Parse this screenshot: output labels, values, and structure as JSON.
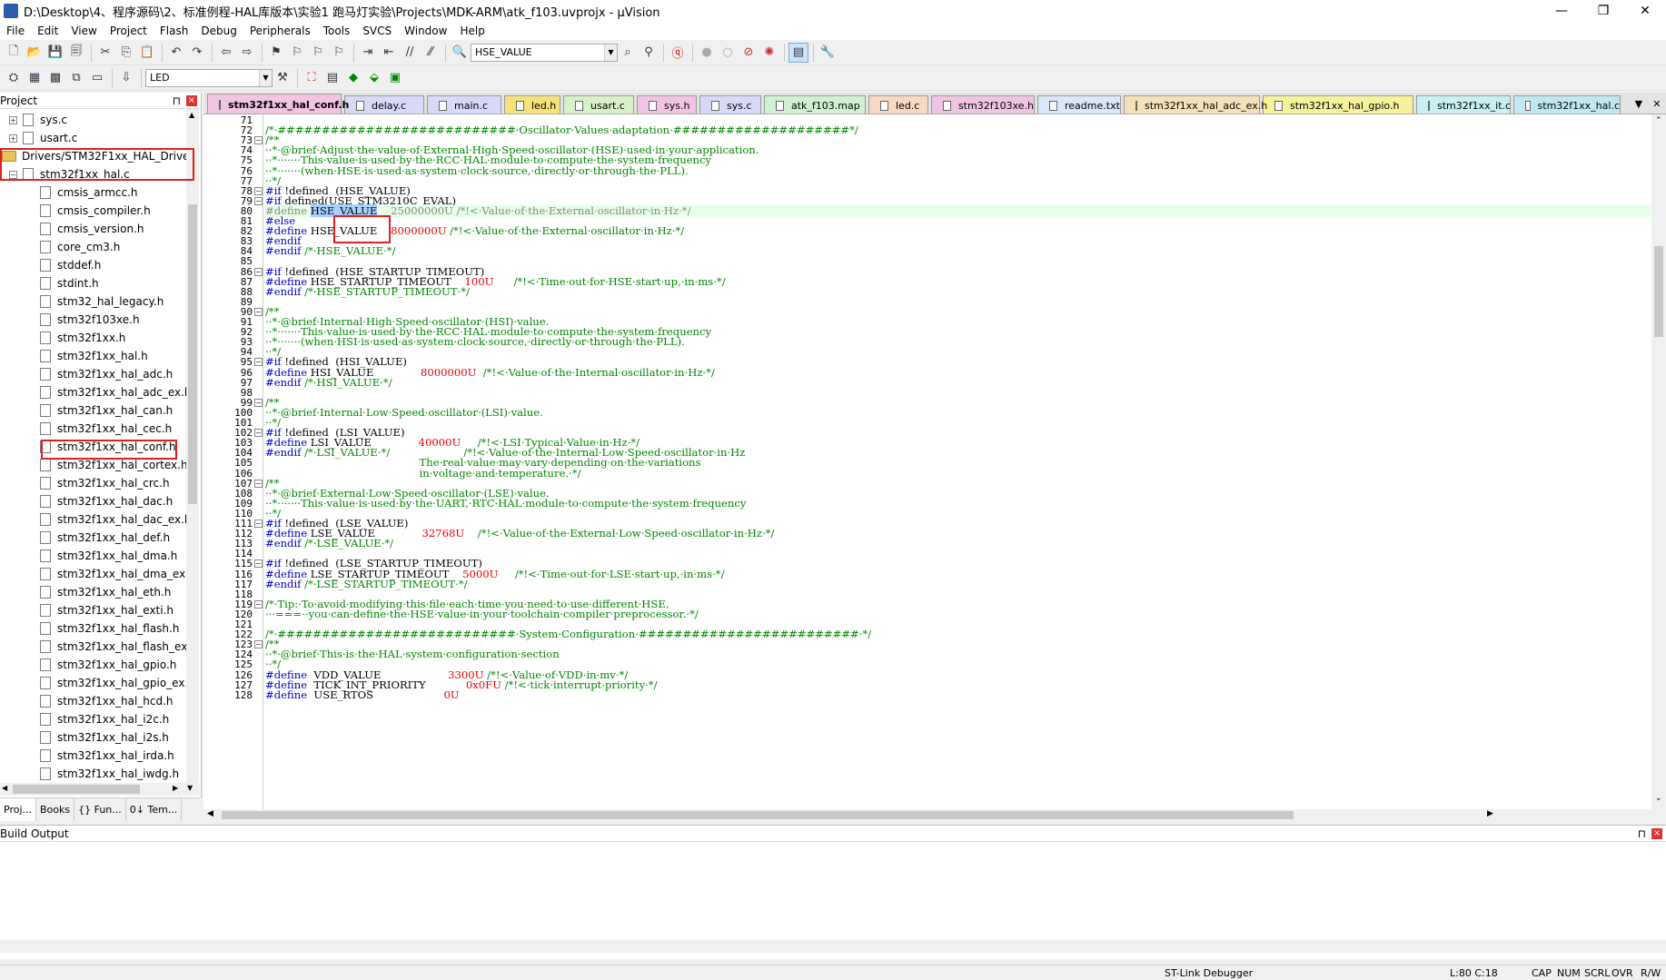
{
  "window": {
    "title": "D:\\Desktop\\4、程序源码\\2、标准例程-HAL库版本\\实验1 跑马灯实验\\Projects\\MDK-ARM\\atk_f103.uvprojx - µVision",
    "minimize": "—",
    "maximize": "❐",
    "close": "✕"
  },
  "menu": [
    "File",
    "Edit",
    "View",
    "Project",
    "Flash",
    "Debug",
    "Peripherals",
    "Tools",
    "SVCS",
    "Window",
    "Help"
  ],
  "toolbar": {
    "find_value": "HSE_VALUE",
    "target_value": "LED"
  },
  "project": {
    "title": "Project",
    "pin": "⊓",
    "close": "×",
    "items": [
      {
        "label": "sys.c",
        "kind": "file-expand"
      },
      {
        "label": "usart.c",
        "kind": "file-expand"
      },
      {
        "label": "Drivers/STM32F1xx_HAL_Driver",
        "kind": "folder"
      },
      {
        "label": "stm32f1xx_hal.c",
        "kind": "file-collapse"
      },
      {
        "label": "cmsis_armcc.h",
        "kind": "file"
      },
      {
        "label": "cmsis_compiler.h",
        "kind": "file"
      },
      {
        "label": "cmsis_version.h",
        "kind": "file"
      },
      {
        "label": "core_cm3.h",
        "kind": "file"
      },
      {
        "label": "stddef.h",
        "kind": "file"
      },
      {
        "label": "stdint.h",
        "kind": "file"
      },
      {
        "label": "stm32_hal_legacy.h",
        "kind": "file"
      },
      {
        "label": "stm32f103xe.h",
        "kind": "file"
      },
      {
        "label": "stm32f1xx.h",
        "kind": "file"
      },
      {
        "label": "stm32f1xx_hal.h",
        "kind": "file"
      },
      {
        "label": "stm32f1xx_hal_adc.h",
        "kind": "file"
      },
      {
        "label": "stm32f1xx_hal_adc_ex.h",
        "kind": "file"
      },
      {
        "label": "stm32f1xx_hal_can.h",
        "kind": "file"
      },
      {
        "label": "stm32f1xx_hal_cec.h",
        "kind": "file"
      },
      {
        "label": "stm32f1xx_hal_conf.h",
        "kind": "file"
      },
      {
        "label": "stm32f1xx_hal_cortex.h",
        "kind": "file"
      },
      {
        "label": "stm32f1xx_hal_crc.h",
        "kind": "file"
      },
      {
        "label": "stm32f1xx_hal_dac.h",
        "kind": "file"
      },
      {
        "label": "stm32f1xx_hal_dac_ex.h",
        "kind": "file"
      },
      {
        "label": "stm32f1xx_hal_def.h",
        "kind": "file"
      },
      {
        "label": "stm32f1xx_hal_dma.h",
        "kind": "file"
      },
      {
        "label": "stm32f1xx_hal_dma_ex.h",
        "kind": "file"
      },
      {
        "label": "stm32f1xx_hal_eth.h",
        "kind": "file"
      },
      {
        "label": "stm32f1xx_hal_exti.h",
        "kind": "file"
      },
      {
        "label": "stm32f1xx_hal_flash.h",
        "kind": "file"
      },
      {
        "label": "stm32f1xx_hal_flash_ex.h",
        "kind": "file"
      },
      {
        "label": "stm32f1xx_hal_gpio.h",
        "kind": "file"
      },
      {
        "label": "stm32f1xx_hal_gpio_ex.h",
        "kind": "file"
      },
      {
        "label": "stm32f1xx_hal_hcd.h",
        "kind": "file"
      },
      {
        "label": "stm32f1xx_hal_i2c.h",
        "kind": "file"
      },
      {
        "label": "stm32f1xx_hal_i2s.h",
        "kind": "file"
      },
      {
        "label": "stm32f1xx_hal_irda.h",
        "kind": "file"
      },
      {
        "label": "stm32f1xx_hal_iwdg.h",
        "kind": "file"
      }
    ],
    "tabs": [
      "Proj...",
      "Books",
      "{} Fun...",
      "0↓ Tem..."
    ]
  },
  "file_tabs": [
    {
      "label": "stm32f1xx_hal_conf.h",
      "color": "#f2c4e4",
      "active": true
    },
    {
      "label": "delay.c",
      "color": "#d8d8f8"
    },
    {
      "label": "main.c",
      "color": "#d8d8f8"
    },
    {
      "label": "led.h",
      "color": "#f6e27a"
    },
    {
      "label": "usart.c",
      "color": "#d8f0c8"
    },
    {
      "label": "sys.h",
      "color": "#f2c4e4"
    },
    {
      "label": "sys.c",
      "color": "#d8d8f8"
    },
    {
      "label": "atk_f103.map",
      "color": "#d0f0d0"
    },
    {
      "label": "led.c",
      "color": "#f8d8c0"
    },
    {
      "label": "stm32f103xe.h",
      "color": "#f2c4e4"
    },
    {
      "label": "readme.txt",
      "color": "#d8e8f8"
    },
    {
      "label": "stm32f1xx_hal_adc_ex.h",
      "color": "#f6e0b8"
    },
    {
      "label": "stm32f1xx_hal_gpio.h",
      "color": "#f6f29a"
    },
    {
      "label": "stm32f1xx_it.c",
      "color": "#c8f0f0"
    },
    {
      "label": "stm32f1xx_hal.c",
      "color": "#c0e8f0"
    }
  ],
  "tab_controls": {
    "list": "▼",
    "close": "✕"
  },
  "code": [
    {
      "n": "71",
      "segs": []
    },
    {
      "n": "72",
      "segs": [
        [
          "cm",
          "/*·###########################·Oscillator·Values·adaptation·####################*/"
        ]
      ]
    },
    {
      "n": "73",
      "fold": "−",
      "segs": [
        [
          "cm",
          "/**"
        ]
      ]
    },
    {
      "n": "74",
      "segs": [
        [
          "cm",
          "··*·@brief·Adjust·the·value·of·External·High·Speed·oscillator·(HSE)·used·in·your·application."
        ]
      ]
    },
    {
      "n": "75",
      "segs": [
        [
          "cm",
          "··*·······This·value·is·used·by·the·RCC·HAL·module·to·compute·the·system·frequency"
        ]
      ]
    },
    {
      "n": "76",
      "segs": [
        [
          "cm",
          "··*·······(when·HSE·is·used·as·system·clock·source,·directly·or·through·the·PLL)."
        ]
      ]
    },
    {
      "n": "77",
      "segs": [
        [
          "cm",
          "··*/"
        ]
      ]
    },
    {
      "n": "78",
      "fold": "−",
      "segs": [
        [
          "df",
          "#if"
        ],
        [
          "",
          " !defined  (HSE_VALUE)"
        ]
      ]
    },
    {
      "n": "79",
      "fold": "−",
      "segs": [
        [
          "df",
          "#if"
        ],
        [
          "",
          " defined(USE_STM3210C_EVAL)"
        ]
      ]
    },
    {
      "n": "80",
      "hl": true,
      "segs": [
        [
          "dim",
          "#define "
        ],
        [
          "sel",
          "HSE_VALUE"
        ],
        [
          "dim",
          "    25000000U /*!<·Value·of·the·External·oscillator·in·Hz·*/"
        ]
      ]
    },
    {
      "n": "81",
      "segs": [
        [
          "df",
          "#else"
        ]
      ]
    },
    {
      "n": "82",
      "segs": [
        [
          "df",
          "#define"
        ],
        [
          "",
          " HSE_VALUE    "
        ],
        [
          "nm",
          "8000000U"
        ],
        [
          "cm",
          " /*!<·Value·of·the·External·oscillator·in·Hz·*/"
        ]
      ]
    },
    {
      "n": "83",
      "segs": [
        [
          "df",
          "#endif"
        ]
      ]
    },
    {
      "n": "84",
      "segs": [
        [
          "df",
          "#endif"
        ],
        [
          "cm",
          " /*·HSE_VALUE·*/"
        ]
      ]
    },
    {
      "n": "85",
      "segs": []
    },
    {
      "n": "86",
      "fold": "−",
      "segs": [
        [
          "df",
          "#if"
        ],
        [
          "",
          " !defined  (HSE_STARTUP_TIMEOUT)"
        ]
      ]
    },
    {
      "n": "87",
      "segs": [
        [
          "df",
          "#define"
        ],
        [
          "",
          " HSE_STARTUP_TIMEOUT    "
        ],
        [
          "nm",
          "100U"
        ],
        [
          "",
          "      "
        ],
        [
          "cm",
          "/*!<·Time·out·for·HSE·start·up,·in·ms·*/"
        ]
      ]
    },
    {
      "n": "88",
      "segs": [
        [
          "df",
          "#endif"
        ],
        [
          "cm",
          " /*·HSE_STARTUP_TIMEOUT·*/"
        ]
      ]
    },
    {
      "n": "89",
      "segs": []
    },
    {
      "n": "90",
      "fold": "−",
      "segs": [
        [
          "cm",
          "/**"
        ]
      ]
    },
    {
      "n": "91",
      "segs": [
        [
          "cm",
          "··*·@brief·Internal·High·Speed·oscillator·(HSI)·value."
        ]
      ]
    },
    {
      "n": "92",
      "segs": [
        [
          "cm",
          "··*·······This·value·is·used·by·the·RCC·HAL·module·to·compute·the·system·frequency"
        ]
      ]
    },
    {
      "n": "93",
      "segs": [
        [
          "cm",
          "··*·······(when·HSI·is·used·as·system·clock·source,·directly·or·through·the·PLL)."
        ]
      ]
    },
    {
      "n": "94",
      "segs": [
        [
          "cm",
          "··*/"
        ]
      ]
    },
    {
      "n": "95",
      "fold": "−",
      "segs": [
        [
          "df",
          "#if"
        ],
        [
          "",
          " !defined  (HSI_VALUE)"
        ]
      ]
    },
    {
      "n": "96",
      "segs": [
        [
          "df",
          "#define"
        ],
        [
          "",
          " HSI_VALUE              "
        ],
        [
          "nm",
          "8000000U"
        ],
        [
          "cm",
          "  /*!<·Value·of·the·Internal·oscillator·in·Hz·*/"
        ]
      ]
    },
    {
      "n": "97",
      "segs": [
        [
          "df",
          "#endif"
        ],
        [
          "cm",
          " /*·HSI_VALUE·*/"
        ]
      ]
    },
    {
      "n": "98",
      "segs": []
    },
    {
      "n": "99",
      "fold": "−",
      "segs": [
        [
          "cm",
          "/**"
        ]
      ]
    },
    {
      "n": "100",
      "segs": [
        [
          "cm",
          "··*·@brief·Internal·Low·Speed·oscillator·(LSI)·value."
        ]
      ]
    },
    {
      "n": "101",
      "segs": [
        [
          "cm",
          "··*/"
        ]
      ]
    },
    {
      "n": "102",
      "fold": "−",
      "segs": [
        [
          "df",
          "#if"
        ],
        [
          "",
          " !defined  (LSI_VALUE)"
        ]
      ]
    },
    {
      "n": "103",
      "segs": [
        [
          "df",
          "#define"
        ],
        [
          "",
          " LSI_VALUE              "
        ],
        [
          "nm",
          "40000U"
        ],
        [
          "",
          "     "
        ],
        [
          "cm",
          "/*!<·LSI·Typical·Value·in·Hz·*/"
        ]
      ]
    },
    {
      "n": "104",
      "segs": [
        [
          "df",
          "#endif"
        ],
        [
          "cm",
          " /*·LSI_VALUE·*/                      /*!<·Value·of·the·Internal·Low·Speed·oscillator·in·Hz"
        ]
      ]
    },
    {
      "n": "105",
      "segs": [
        [
          "cm",
          "                                              The·real·value·may·vary·depending·on·the·variations"
        ]
      ]
    },
    {
      "n": "106",
      "segs": [
        [
          "cm",
          "                                              in·voltage·and·temperature.·*/"
        ]
      ]
    },
    {
      "n": "107",
      "fold": "−",
      "segs": [
        [
          "cm",
          "/**"
        ]
      ]
    },
    {
      "n": "108",
      "segs": [
        [
          "cm",
          "··*·@brief·External·Low·Speed·oscillator·(LSE)·value."
        ]
      ]
    },
    {
      "n": "109",
      "segs": [
        [
          "cm",
          "··*·······This·value·is·used·by·the·UART,·RTC·HAL·module·to·compute·the·system·frequency"
        ]
      ]
    },
    {
      "n": "110",
      "segs": [
        [
          "cm",
          "··*/"
        ]
      ]
    },
    {
      "n": "111",
      "fold": "−",
      "segs": [
        [
          "df",
          "#if"
        ],
        [
          "",
          " !defined  (LSE_VALUE)"
        ]
      ]
    },
    {
      "n": "112",
      "segs": [
        [
          "df",
          "#define"
        ],
        [
          "",
          " LSE_VALUE              "
        ],
        [
          "nm",
          "32768U"
        ],
        [
          "",
          "    "
        ],
        [
          "cm",
          "/*!<·Value·of·the·External·Low·Speed·oscillator·in·Hz·*/"
        ]
      ]
    },
    {
      "n": "113",
      "segs": [
        [
          "df",
          "#endif"
        ],
        [
          "cm",
          " /*·LSE_VALUE·*/"
        ]
      ]
    },
    {
      "n": "114",
      "segs": []
    },
    {
      "n": "115",
      "fold": "−",
      "segs": [
        [
          "df",
          "#if"
        ],
        [
          "",
          " !defined  (LSE_STARTUP_TIMEOUT)"
        ]
      ]
    },
    {
      "n": "116",
      "segs": [
        [
          "df",
          "#define"
        ],
        [
          "",
          " LSE_STARTUP_TIMEOUT    "
        ],
        [
          "nm",
          "5000U"
        ],
        [
          "",
          "     "
        ],
        [
          "cm",
          "/*!<·Time·out·for·LSE·start·up,·in·ms·*/"
        ]
      ]
    },
    {
      "n": "117",
      "segs": [
        [
          "df",
          "#endif"
        ],
        [
          "cm",
          " /*·LSE_STARTUP_TIMEOUT·*/"
        ]
      ]
    },
    {
      "n": "118",
      "segs": []
    },
    {
      "n": "119",
      "fold": "−",
      "segs": [
        [
          "cm",
          "/*·Tip:·To·avoid·modifying·this·file·each·time·you·need·to·use·different·HSE,"
        ]
      ]
    },
    {
      "n": "120",
      "segs": [
        [
          "cm",
          "···===··you·can·define·the·HSE·value·in·your·toolchain·compiler·preprocessor.·*/"
        ]
      ]
    },
    {
      "n": "121",
      "segs": []
    },
    {
      "n": "122",
      "segs": [
        [
          "cm",
          "/*·###########################·System·Configuration·#########################·*/"
        ]
      ]
    },
    {
      "n": "123",
      "fold": "−",
      "segs": [
        [
          "cm",
          "/**"
        ]
      ]
    },
    {
      "n": "124",
      "segs": [
        [
          "cm",
          "··*·@brief·This·is·the·HAL·system·configuration·section"
        ]
      ]
    },
    {
      "n": "125",
      "segs": [
        [
          "cm",
          "··*/"
        ]
      ]
    },
    {
      "n": "126",
      "segs": [
        [
          "df",
          "#define"
        ],
        [
          "",
          "  VDD_VALUE                    "
        ],
        [
          "nm",
          "3300U"
        ],
        [
          "cm",
          " /*!<·Value·of·VDD·in·mv·*/"
        ]
      ]
    },
    {
      "n": "127",
      "segs": [
        [
          "df",
          "#define"
        ],
        [
          "",
          "  TICK_INT_PRIORITY            "
        ],
        [
          "nm",
          "0x0FU"
        ],
        [
          "cm",
          " /*!<·tick·interrupt·priority·*/"
        ]
      ]
    },
    {
      "n": "128",
      "segs": [
        [
          "df",
          "#define"
        ],
        [
          "",
          "  USE_RTOS                     "
        ],
        [
          "nm",
          "0U"
        ]
      ]
    }
  ],
  "build": {
    "title": "Build Output"
  },
  "status": {
    "debugger": "ST-Link Debugger",
    "position": "L:80 C:18",
    "caps": "CAP",
    "num": "NUM",
    "scrl": "SCRL",
    "ovr": "OVR",
    "rw": "R/W"
  }
}
